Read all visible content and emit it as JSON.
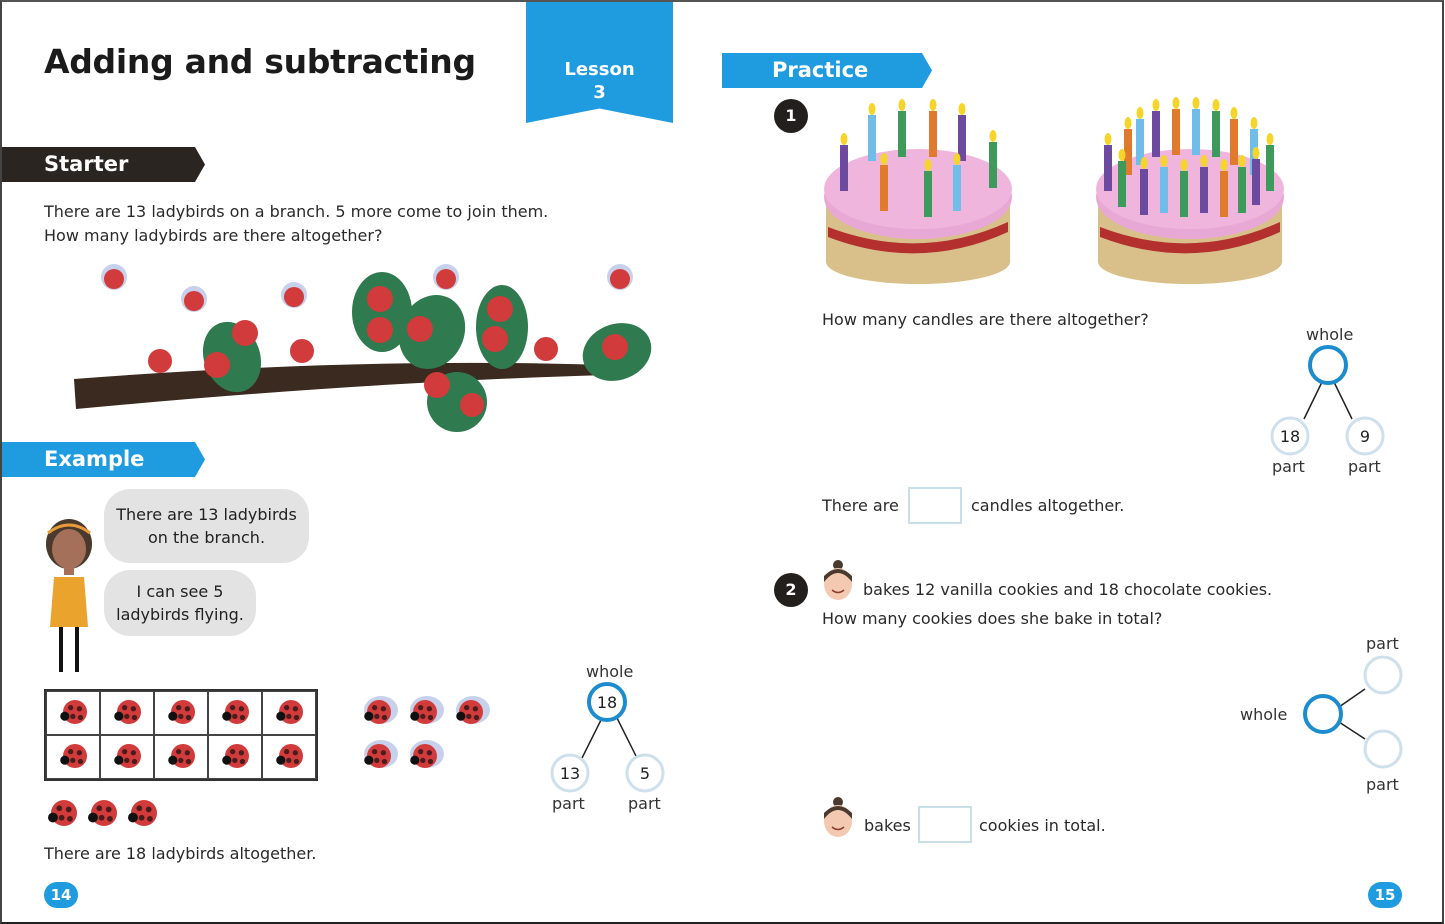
{
  "left_page": {
    "title": "Adding and subtracting",
    "lesson_flag": {
      "line1": "Lesson",
      "line2": "3"
    },
    "starter": {
      "heading": "Starter",
      "line1": "There are 13 ladybirds on a branch. 5 more come to join them.",
      "line2": "How many ladybirds are there altogether?"
    },
    "example": {
      "heading": "Example",
      "bubble1_line1": "There are 13 ladybirds",
      "bubble1_line2": "on the branch.",
      "bubble2_line1": "I can see 5",
      "bubble2_line2": "ladybirds flying.",
      "conclusion": "There are 18 ladybirds altogether.",
      "part_whole": {
        "whole_label": "whole",
        "whole_value": "18",
        "part_label": "part",
        "part1_value": "13",
        "part2_value": "5"
      }
    },
    "page_number": "14"
  },
  "right_page": {
    "practice_heading": "Practice",
    "q1": {
      "number": "1",
      "question": "How many candles are there altogether?",
      "answer_prefix": "There are",
      "answer_suffix": "candles altogether.",
      "answer_value": "",
      "part_whole": {
        "whole_label": "whole",
        "whole_value": "",
        "part_label": "part",
        "part1_value": "18",
        "part2_value": "9"
      }
    },
    "q2": {
      "number": "2",
      "line1": "bakes 12 vanilla cookies and 18 chocolate cookies.",
      "line2": "How many cookies does she bake in total?",
      "answer_prefix": "bakes",
      "answer_suffix": "cookies in total.",
      "answer_value": "",
      "part_whole": {
        "whole_label": "whole",
        "part_label": "part"
      }
    },
    "page_number": "15"
  },
  "colors": {
    "accent_blue": "#1f9be0",
    "dark_banner": "#2b2522",
    "ladybird_red": "#d13b3b",
    "leaf_green": "#2f7a4f",
    "branch_brown": "#3b2a1f",
    "icing_pink": "#e7a8d6"
  }
}
